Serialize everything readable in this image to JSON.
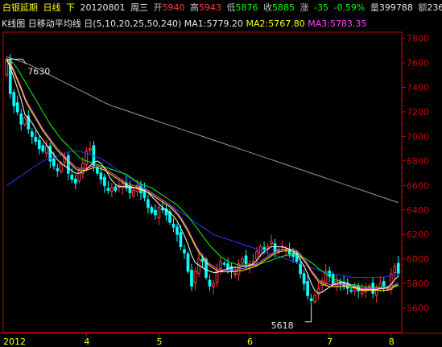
{
  "header": {
    "name": "白银延期",
    "period": "日线",
    "direction": "下",
    "date": "20120801",
    "weekday": "周三",
    "open_label": "开",
    "open": "5940",
    "high_label": "高",
    "high": "5943",
    "low_label": "低",
    "low": "5876",
    "close_label": "收",
    "close": "5885",
    "change_label": "涨",
    "change": "-35",
    "change_pct": "-0.59%",
    "volume_label": "量",
    "volume": "399788",
    "amount_label": "额",
    "amount": "2361"
  },
  "indicator_bar": {
    "chart_label": "K线图",
    "ma_label": "日移动平均线",
    "period_label": "日",
    "params": "(5,10,20,25,50,240)",
    "ma1": "MA1:5779.20",
    "ma2": "MA2:5767.80",
    "ma3": "MA3:5783.35"
  },
  "colors": {
    "up": "#ff3b3b",
    "down": "#00ffff",
    "ma1": "#ffffff",
    "ma2": "#ffff00",
    "ma3": "#ff44ff",
    "ma4": "#00ff00",
    "ma5": "#3333ff",
    "ma6": "#9a9a8a",
    "axis": "#cc0000"
  },
  "chart_data": {
    "type": "candlestick",
    "ylim": [
      5400,
      7850
    ],
    "y_ticks": [
      5600,
      5800,
      6000,
      6200,
      6400,
      6600,
      6800,
      7000,
      7200,
      7400,
      7600,
      7800
    ],
    "x_labels": [
      "2012",
      "4",
      "5",
      "6",
      "7",
      "8"
    ],
    "annotations": [
      {
        "text": "7630",
        "value": 7630
      },
      {
        "text": "5618",
        "value": 5618
      }
    ],
    "close": [
      7630,
      7350,
      7250,
      7200,
      7100,
      7150,
      7060,
      7000,
      6960,
      6900,
      6880,
      6920,
      6800,
      6760,
      6720,
      6780,
      6820,
      6700,
      6650,
      6620,
      6720,
      6780,
      6880,
      6900,
      6760,
      6700,
      6650,
      6600,
      6560,
      6580,
      6560,
      6600,
      6620,
      6580,
      6540,
      6560,
      6600,
      6540,
      6500,
      6420,
      6380,
      6360,
      6420,
      6400,
      6360,
      6300,
      6260,
      6200,
      6100,
      6050,
      5900,
      5780,
      5900,
      6000,
      5980,
      5850,
      5780,
      5800,
      5900,
      5980,
      5960,
      5920,
      5900,
      5880,
      5960,
      6000,
      5960,
      5960,
      5980,
      6060,
      6100,
      6080,
      6100,
      6140,
      6060,
      6080,
      6100,
      6080,
      6040,
      6020,
      5980,
      5880,
      5800,
      5700,
      5660,
      5700,
      5760,
      5820,
      5900,
      5860,
      5800,
      5820,
      5800,
      5780,
      5760,
      5740,
      5760,
      5740,
      5740,
      5760,
      5780,
      5720,
      5760,
      5800,
      5780,
      5760,
      5880,
      5940,
      5885
    ],
    "ma5": [
      7630,
      7560,
      7480,
      7390,
      7300,
      7180,
      7150,
      7110,
      7060,
      7010,
      6970,
      6930,
      6890,
      6850,
      6810,
      6780,
      6760,
      6740,
      6720,
      6700,
      6700,
      6710,
      6730,
      6760,
      6790,
      6800,
      6780,
      6740,
      6690,
      6640,
      6610,
      6590,
      6590,
      6590,
      6580,
      6580,
      6580,
      6570,
      6560,
      6540,
      6510,
      6480,
      6450,
      6420,
      6400,
      6380,
      6350,
      6310,
      6250,
      6190,
      6120,
      6030,
      5970,
      5950,
      5930,
      5910,
      5900,
      5890,
      5890,
      5900,
      5910,
      5920,
      5930,
      5930,
      5930,
      5940,
      5940,
      5950,
      5960,
      5990,
      6030,
      6060,
      6080,
      6100,
      6100,
      6100,
      6100,
      6090,
      6080,
      6060,
      6040,
      5990,
      5940,
      5880,
      5800,
      5740,
      5720,
      5730,
      5750,
      5770,
      5790,
      5800,
      5810,
      5810,
      5800,
      5780,
      5770,
      5760,
      5750,
      5750,
      5750,
      5750,
      5750,
      5760,
      5760,
      5770,
      5790,
      5830,
      5860
    ],
    "ma10": [
      7630,
      7600,
      7540,
      7470,
      7400,
      7320,
      7260,
      7210,
      7160,
      7110,
      7060,
      7020,
      6980,
      6940,
      6900,
      6870,
      6840,
      6810,
      6780,
      6750,
      6740,
      6740,
      6740,
      6750,
      6760,
      6760,
      6750,
      6740,
      6720,
      6700,
      6680,
      6660,
      6640,
      6620,
      6610,
      6600,
      6590,
      6580,
      6570,
      6560,
      6540,
      6520,
      6500,
      6480,
      6460,
      6440,
      6410,
      6380,
      6340,
      6290,
      6240,
      6180,
      6120,
      6070,
      6030,
      5990,
      5960,
      5940,
      5920,
      5910,
      5910,
      5910,
      5910,
      5910,
      5920,
      5920,
      5930,
      5940,
      5950,
      5960,
      5980,
      6000,
      6020,
      6040,
      6060,
      6070,
      6080,
      6080,
      6080,
      6080,
      6070,
      6040,
      6000,
      5960,
      5910,
      5870,
      5830,
      5810,
      5800,
      5790,
      5790,
      5790,
      5790,
      5790,
      5790,
      5780,
      5780,
      5770,
      5760,
      5760,
      5760,
      5760,
      5760,
      5760,
      5760,
      5760,
      5770,
      5790,
      5800
    ],
    "ma20": [
      7630,
      7620,
      7590,
      7550,
      7500,
      7450,
      7400,
      7350,
      7300,
      7250,
      7200,
      7150,
      7100,
      7060,
      7020,
      6980,
      6950,
      6920,
      6890,
      6860,
      6830,
      6810,
      6800,
      6790,
      6780,
      6770,
      6760,
      6750,
      6740,
      6730,
      6720,
      6710,
      6700,
      6690,
      6670,
      6650,
      6630,
      6610,
      6600,
      6590,
      6580,
      6560,
      6540,
      6520,
      6500,
      6480,
      6460,
      6440,
      6410,
      6380,
      6350,
      6310,
      6270,
      6230,
      6190,
      6150,
      6110,
      6080,
      6050,
      6020,
      6000,
      5980,
      5970,
      5960,
      5950,
      5950,
      5950,
      5950,
      5950,
      5950,
      5960,
      5970,
      5980,
      5990,
      6000,
      6010,
      6020,
      6030,
      6030,
      6030,
      6030,
      6020,
      6010,
      5990,
      5970,
      5950,
      5920,
      5900,
      5880,
      5860,
      5840,
      5830,
      5820,
      5810,
      5800,
      5790,
      5790,
      5780,
      5780,
      5770,
      5770,
      5770,
      5770,
      5770,
      5770,
      5770,
      5770,
      5780,
      5790
    ],
    "ma50": [
      6600,
      6620,
      6640,
      6660,
      6680,
      6700,
      6720,
      6740,
      6760,
      6780,
      6800,
      6810,
      6820,
      6830,
      6840,
      6850,
      6860,
      6870,
      6880,
      6880,
      6880,
      6870,
      6860,
      6850,
      6840,
      6830,
      6820,
      6800,
      6780,
      6760,
      6740,
      6720,
      6700,
      6680,
      6660,
      6640,
      6620,
      6600,
      6580,
      6560,
      6540,
      6520,
      6500,
      6480,
      6460,
      6440,
      6420,
      6400,
      6380,
      6360,
      6340,
      6320,
      6300,
      6280,
      6260,
      6240,
      6220,
      6200,
      6190,
      6180,
      6170,
      6160,
      6150,
      6140,
      6130,
      6120,
      6110,
      6100,
      6090,
      6080,
      6070,
      6060,
      6050,
      6040,
      6030,
      6020,
      6010,
      6000,
      5990,
      5980,
      5970,
      5960,
      5950,
      5940,
      5930,
      5920,
      5910,
      5900,
      5890,
      5880,
      5880,
      5870,
      5870,
      5860,
      5860,
      5850,
      5850,
      5850,
      5850,
      5850,
      5850,
      5850,
      5850,
      5850,
      5850,
      5860,
      5860,
      5870,
      5880
    ],
    "ma240": [
      7650,
      7640,
      7630,
      7620,
      7610,
      7600,
      7590,
      7575,
      7560,
      7545,
      7530,
      7515,
      7500,
      7485,
      7470,
      7455,
      7440,
      7425,
      7410,
      7395,
      7380,
      7365,
      7350,
      7335,
      7320,
      7305,
      7290,
      7275,
      7262,
      7250,
      7240,
      7230,
      7220,
      7210,
      7200,
      7190,
      7180,
      7170,
      7160,
      7150,
      7140,
      7130,
      7120,
      7110,
      7100,
      7090,
      7080,
      7070,
      7060,
      7050,
      7040,
      7030,
      7020,
      7010,
      7000,
      6990,
      6980,
      6970,
      6960,
      6950,
      6940,
      6930,
      6920,
      6910,
      6900,
      6890,
      6880,
      6870,
      6860,
      6850,
      6840,
      6830,
      6820,
      6810,
      6800,
      6790,
      6780,
      6770,
      6760,
      6750,
      6740,
      6730,
      6720,
      6710,
      6700,
      6690,
      6680,
      6670,
      6660,
      6650,
      6640,
      6630,
      6620,
      6610,
      6600,
      6590,
      6580,
      6570,
      6560,
      6550,
      6540,
      6530,
      6520,
      6510,
      6500,
      6490,
      6480,
      6470,
      6460
    ]
  }
}
